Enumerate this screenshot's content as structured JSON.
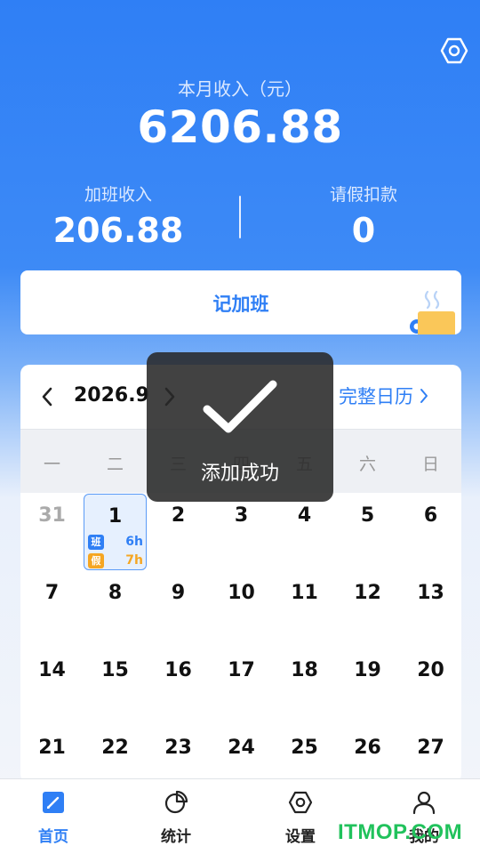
{
  "header": {
    "monthly_income_label": "本月收入（元）",
    "monthly_income_value": "6206.88",
    "overtime_label": "加班收入",
    "overtime_value": "206.88",
    "leave_label": "请假扣款",
    "leave_value": "0"
  },
  "record_button": {
    "label": "记加班"
  },
  "calendar": {
    "month": "2026.9",
    "full_calendar_link": "完整日历",
    "weekdays": [
      "一",
      "二",
      "三",
      "四",
      "五",
      "六",
      "日"
    ],
    "days": [
      [
        "31",
        "1",
        "2",
        "3",
        "4",
        "5",
        "6"
      ],
      [
        "7",
        "8",
        "9",
        "10",
        "11",
        "12",
        "13"
      ],
      [
        "14",
        "15",
        "16",
        "17",
        "18",
        "19",
        "20"
      ],
      [
        "21",
        "22",
        "23",
        "24",
        "25",
        "26",
        "27"
      ]
    ],
    "selected_day_tags": {
      "overtime_tag": "班",
      "overtime_hours": "6h",
      "leave_tag": "假",
      "leave_hours": "7h"
    }
  },
  "toast": {
    "message": "添加成功"
  },
  "tabbar": {
    "items": [
      {
        "label": "首页",
        "icon": "edit-icon"
      },
      {
        "label": "统计",
        "icon": "pie-chart-icon"
      },
      {
        "label": "设置",
        "icon": "hexagon-settings-icon"
      },
      {
        "label": "我的",
        "icon": "user-icon"
      }
    ]
  },
  "watermark": "ITMOP.COM",
  "colors": {
    "accent": "#2F7FF5",
    "leave": "#F5A623",
    "watermark": "#21C25C"
  }
}
